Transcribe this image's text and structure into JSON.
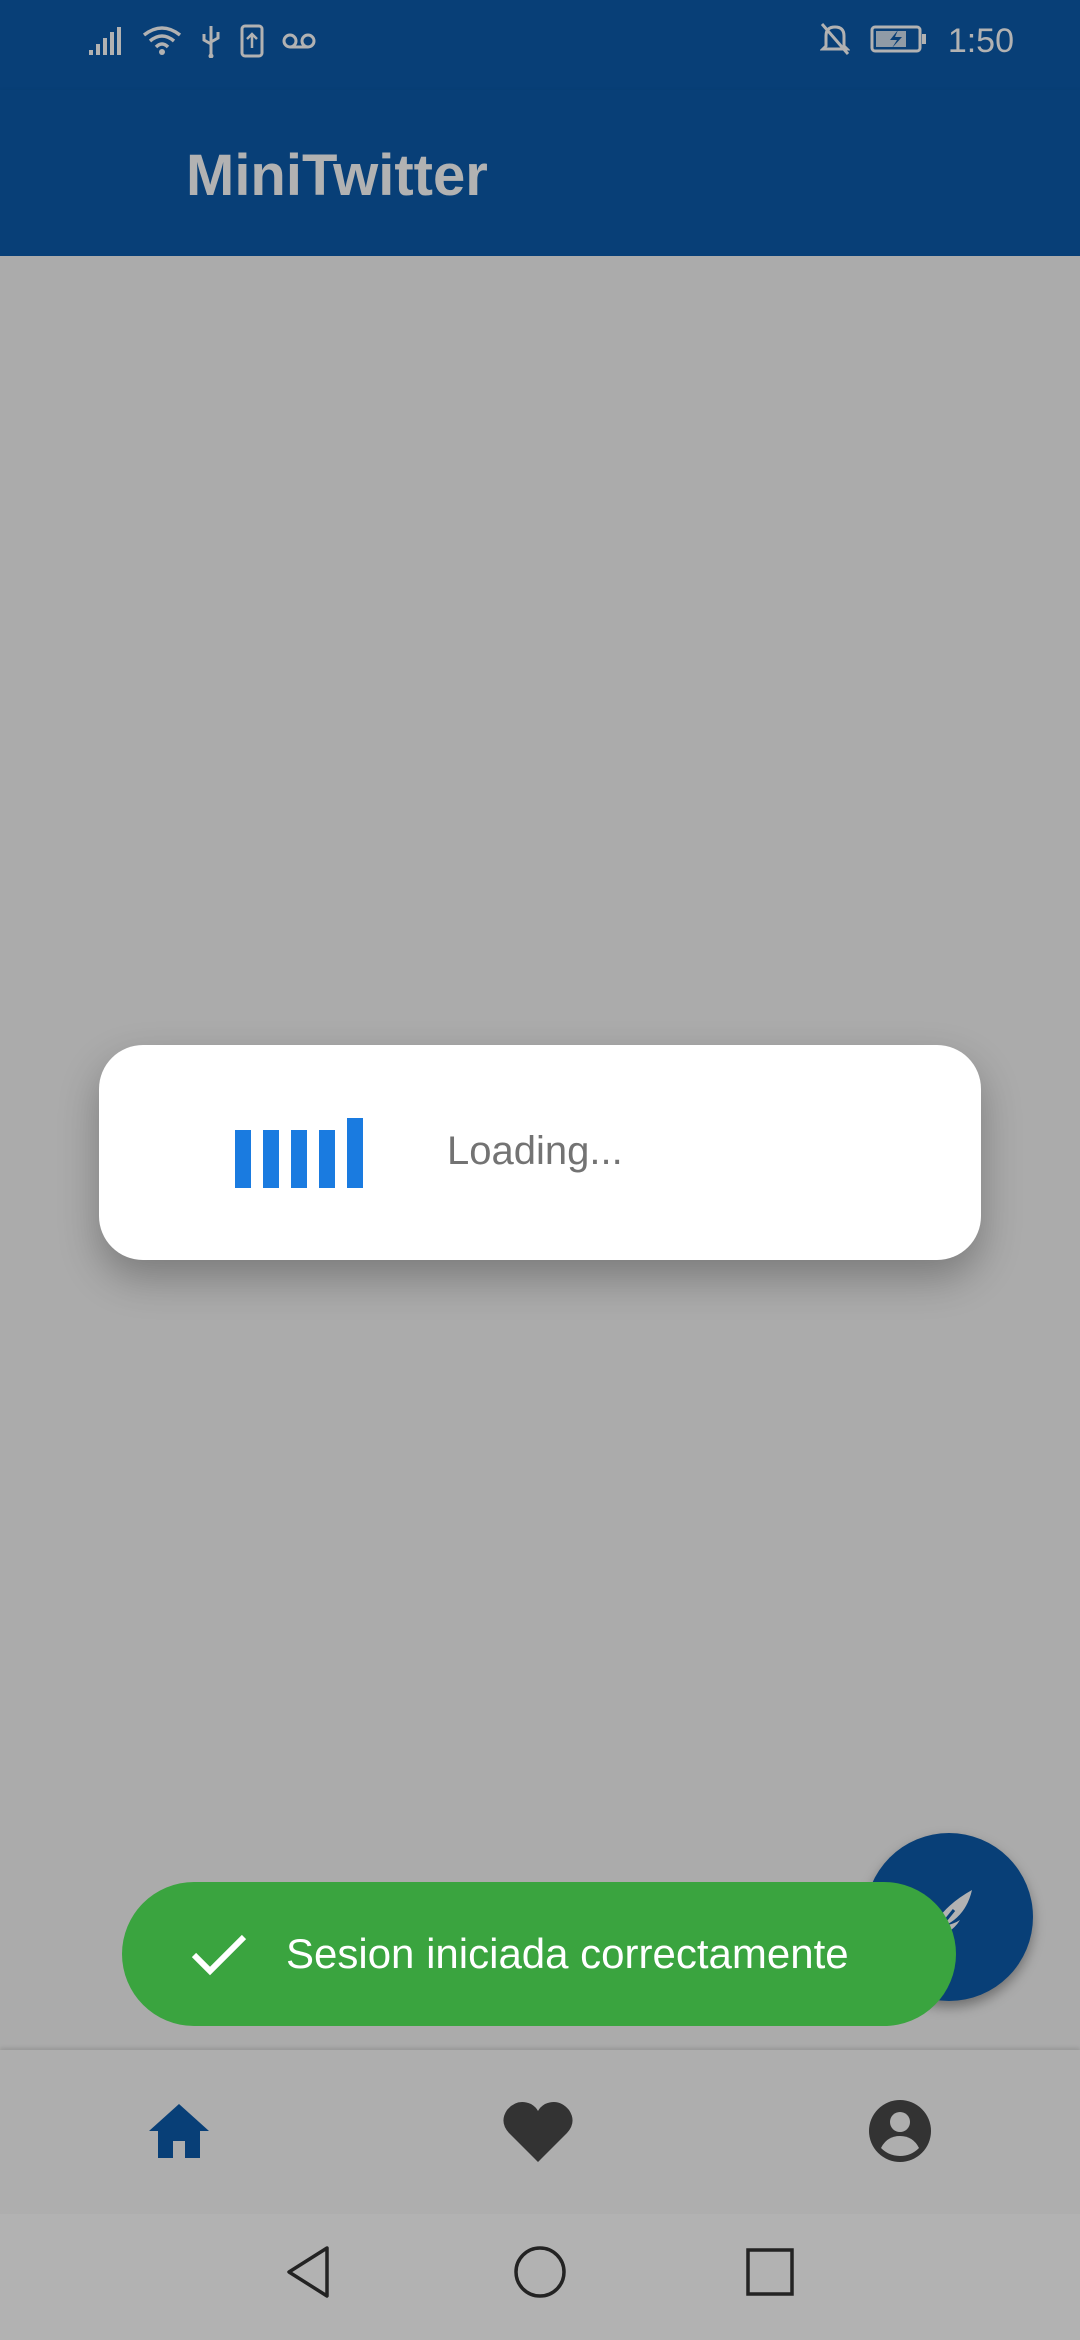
{
  "status_bar": {
    "time": "1:50",
    "icons_left": [
      "signal-icon",
      "wifi-icon",
      "usb-icon",
      "sim-icon",
      "voicemail-icon"
    ],
    "icons_right": [
      "notifications-off-icon",
      "battery-charging-icon"
    ]
  },
  "app_bar": {
    "title": "MiniTwitter",
    "background": "#0c5bab"
  },
  "loading_dialog": {
    "text": "Loading...",
    "accent": "#1a7be0"
  },
  "toast": {
    "icon": "check-icon",
    "message": "Sesion iniciada correctamente",
    "background": "#3aa43f"
  },
  "fab": {
    "icon": "feather-icon",
    "background": "#0c5bab"
  },
  "bottom_nav": {
    "items": [
      {
        "icon": "home-icon",
        "active": true
      },
      {
        "icon": "heart-icon",
        "active": false
      },
      {
        "icon": "account-icon",
        "active": false
      }
    ],
    "active_color": "#0c5bab",
    "inactive_color": "#4a4a4a"
  },
  "system_nav": {
    "buttons": [
      "back-icon",
      "home-circle-icon",
      "recents-icon"
    ]
  }
}
